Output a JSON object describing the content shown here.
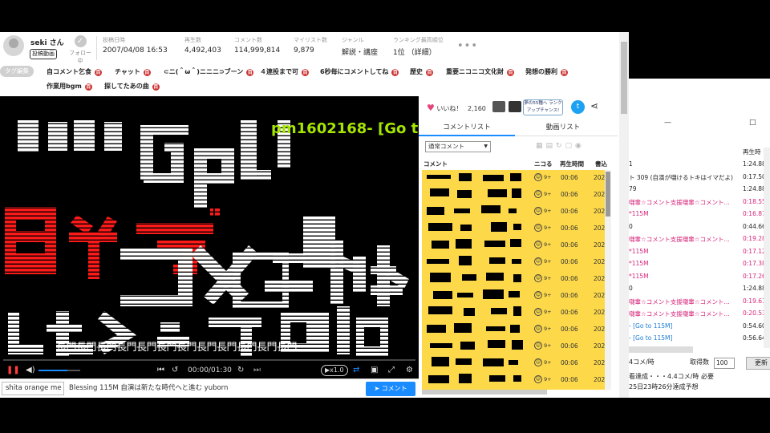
{
  "header": {
    "user": {
      "name": "seki さん",
      "tag": "投稿動画",
      "follow": "フォロー中"
    },
    "stats": [
      {
        "label": "投稿日時",
        "value": "2007/04/08 16:53"
      },
      {
        "label": "再生数",
        "value": "4,492,403"
      },
      {
        "label": "コメント数",
        "value": "114,999,814"
      },
      {
        "label": "マイリスト数",
        "value": "9,879"
      },
      {
        "label": "ジャンル",
        "value": "解説・講座"
      },
      {
        "label": "ランキング最高順位",
        "value": "1位 （詳細）"
      }
    ],
    "more": "•••"
  },
  "tags": {
    "edit_label": "タグ編集",
    "items": [
      "自コメント乞食",
      "チャット",
      "⊂ニ(＾ω＾)ニニニ⊃ブーン",
      "４連投まで可",
      "6秒毎にコメントしてね",
      "歴史",
      "重要ニコニコ文化財",
      "発想の勝利",
      "作業用bgm",
      "探してたあの曲"
    ],
    "dic_icon": "百"
  },
  "player": {
    "overlay_comment": "pm1602168-  [Go to",
    "caption": "長門長門長門長門長門長門長門長門長門長門長門長門",
    "time": "00:00/01:30",
    "speed": "▶x1.0",
    "progress": 0.0,
    "volume": 0.7,
    "comment_command": "shita orange me",
    "comment_input": "Blessing 115M 自演は新たな時代へと進む yuborn",
    "send_label": "コメント"
  },
  "side": {
    "like_label": "いいね！",
    "like_count": "2,160",
    "ad_text": "夢の55種へ ランクアップチャンス!",
    "twitter_icon": "twitter-icon",
    "tabs": [
      "コメントリスト",
      "動画リスト"
    ],
    "filter": "通常コメント",
    "columns": [
      "コメント",
      "ニコる",
      "再生時間",
      "書込"
    ],
    "rows": [
      {
        "nicoru": "9+",
        "time": "00:06",
        "date": "202"
      },
      {
        "nicoru": "9+",
        "time": "00:06",
        "date": "202"
      },
      {
        "nicoru": "9+",
        "time": "00:06",
        "date": "202"
      },
      {
        "nicoru": "9+",
        "time": "00:06",
        "date": "202"
      },
      {
        "nicoru": "9+",
        "time": "00:06",
        "date": "202"
      },
      {
        "nicoru": "9+",
        "time": "00:06",
        "date": "202"
      },
      {
        "nicoru": "9+",
        "time": "00:06",
        "date": "202"
      },
      {
        "nicoru": "9+",
        "time": "00:06",
        "date": "202"
      },
      {
        "nicoru": "9+",
        "time": "00:06",
        "date": "202"
      },
      {
        "nicoru": "9+",
        "time": "00:06",
        "date": "202"
      },
      {
        "nicoru": "9+",
        "time": "00:06",
        "date": "202"
      },
      {
        "nicoru": "9+",
        "time": "00:06",
        "date": "202"
      },
      {
        "nicoru": "9+",
        "time": "00:06",
        "date": "202"
      }
    ]
  },
  "backwin": {
    "controls": [
      "—",
      "□"
    ],
    "header": "再生時",
    "rows": [
      {
        "c": "1",
        "v": "1:24.88",
        "k": ""
      },
      {
        "c": "ト 309 (自演が囃けるトキはイマだよ)",
        "v": "0:17.50",
        "k": ""
      },
      {
        "c": "79",
        "v": "1:24.88",
        "k": ""
      },
      {
        "c": "囃輩☆コメント支援囃輩☆コメント...",
        "v": "0:18.55",
        "k": "pink"
      },
      {
        "c": "*115M",
        "v": "0:16.87",
        "k": "pink"
      },
      {
        "c": "0",
        "v": "0:44.66",
        "k": ""
      },
      {
        "c": "囃輩☆コメント支援囃輩☆コメント...",
        "v": "0:19.28",
        "k": "pink"
      },
      {
        "c": "*115M",
        "v": "0:17.12",
        "k": "pink"
      },
      {
        "c": "*115M",
        "v": "0:17.38",
        "k": "pink"
      },
      {
        "c": "*115M",
        "v": "0:17.26",
        "k": "pink"
      },
      {
        "c": "0",
        "v": "1:24.88",
        "k": ""
      },
      {
        "c": "囃輩☆コメント支援囃輩☆コメント...",
        "v": "0:19.61",
        "k": "pink"
      },
      {
        "c": "囃輩☆コメント支援囃輩☆コメント...",
        "v": "0:20.53",
        "k": "pink"
      },
      {
        "c": "-  [Go to 115M]",
        "v": "0:54.60",
        "k": "lnk"
      },
      {
        "c": "-  [Go to 115M]",
        "v": "0:56.64",
        "k": "lnk"
      }
    ],
    "rate": "4コメ/時",
    "fetch_label": "取得数",
    "fetch_value": "100",
    "update_label": "更新",
    "line2": "看達成・・・4.4コメ/時 必要",
    "line3": "25日23時26分達成予想"
  }
}
